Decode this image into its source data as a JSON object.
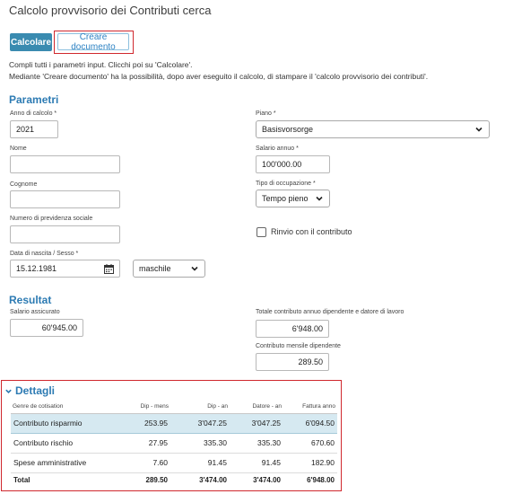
{
  "page": {
    "title": "Calcolo provvisorio dei Contributi cerca"
  },
  "toolbar": {
    "calculate_label": "Calcolare",
    "create_doc_label": "Creare documento"
  },
  "intro": {
    "line1": "Compli tutti i parametri input. Clicchi poi su 'Calcolare'.",
    "line2": "Mediante 'Creare documento' ha la possibilità, dopo aver eseguito il calcolo, di stampare il 'calcolo provvisorio dei contributi'."
  },
  "parametri": {
    "heading": "Parametri",
    "anno_label": "Anno di calcolo *",
    "anno_value": "2021",
    "nome_label": "Nome",
    "nome_value": "",
    "cognome_label": "Cognome",
    "cognome_value": "",
    "previdenza_label": "Numero di previdenza sociale",
    "previdenza_value": "",
    "nascita_label": "Data di nascita / Sesso *",
    "nascita_value": "15.12.1981",
    "sesso_value": "maschile",
    "piano_label": "Piano *",
    "piano_value": "Basisvorsorge",
    "salario_label": "Salario annuo *",
    "salario_value": "100'000.00",
    "occupazione_label": "Tipo di occupazione *",
    "occupazione_value": "Tempo pieno",
    "rinvio_label": "Rinvio con il contributo",
    "rinvio_checked": false
  },
  "resultat": {
    "heading": "Resultat",
    "salario_assicurato_label": "Salario assicurato",
    "salario_assicurato_value": "60'945.00",
    "totale_label": "Totale contributo annuo dipendente e datore di lavoro",
    "totale_value": "6'948.00",
    "mensile_label": "Contributo mensile dipendente",
    "mensile_value": "289.50"
  },
  "dettagli": {
    "heading": "Dettagli",
    "columns": [
      "Genre de cotisation",
      "Dip - mens",
      "Dip - an",
      "Datore - an",
      "Fattura anno"
    ],
    "rows": [
      [
        "Contributo risparmio",
        "253.95",
        "3'047.25",
        "3'047.25",
        "6'094.50"
      ],
      [
        "Contributo rischio",
        "27.95",
        "335.30",
        "335.30",
        "670.60"
      ],
      [
        "Spese amministrative",
        "7.60",
        "91.45",
        "91.45",
        "182.90"
      ]
    ],
    "total": [
      "Total",
      "289.50",
      "3'474.00",
      "3'474.00",
      "6'948.00"
    ]
  },
  "colors": {
    "accent": "#2d7bb3",
    "primary_button": "#3a8bb0",
    "highlight_border": "#d0282e",
    "row_highlight": "#d6e9f1"
  },
  "icons": {
    "calendar": "calendar-icon",
    "dropdown": "chevron-down-icon",
    "collapse": "chevron-down-icon"
  }
}
